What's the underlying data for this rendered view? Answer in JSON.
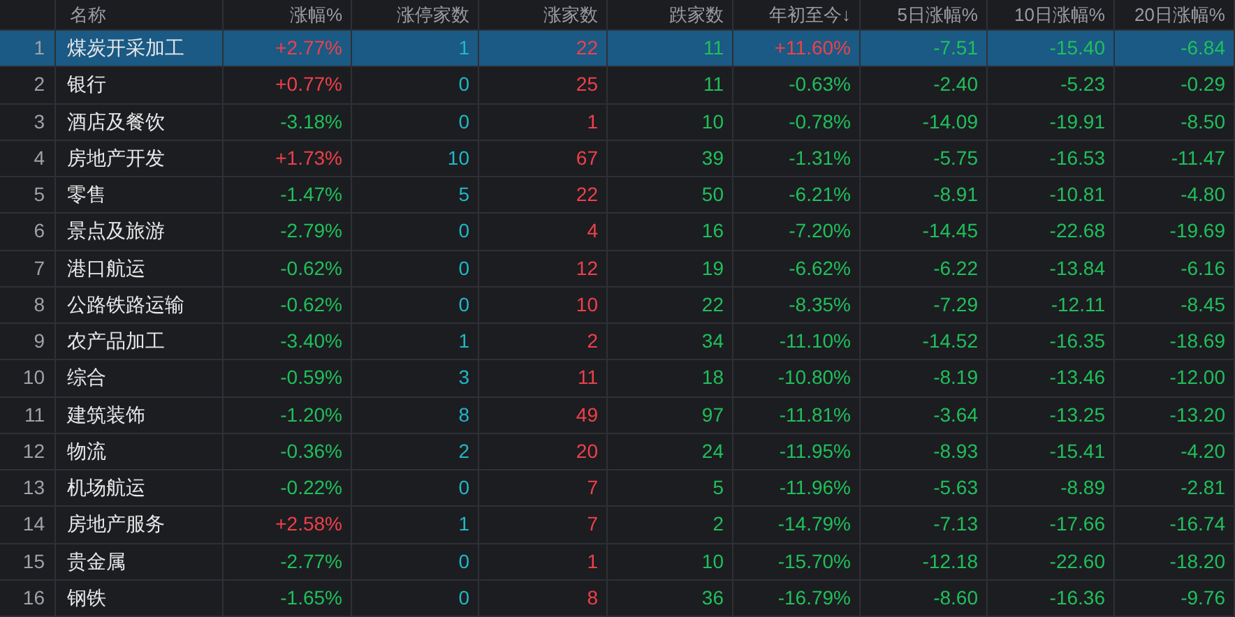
{
  "table": {
    "columns": [
      {
        "kind": "index"
      },
      {
        "label": "名称",
        "kind": "name"
      },
      {
        "label": "涨幅%",
        "kind": "change"
      },
      {
        "label": "涨停家数",
        "kind": "limit"
      },
      {
        "label": "涨家数",
        "kind": "up"
      },
      {
        "label": "跌家数",
        "kind": "down"
      },
      {
        "label": "年初至今↓",
        "kind": "change"
      },
      {
        "label": "5日涨幅%",
        "kind": "change"
      },
      {
        "label": "10日涨幅%",
        "kind": "change"
      },
      {
        "label": "20日涨幅%",
        "kind": "change"
      }
    ],
    "rows": [
      {
        "selected": true,
        "cells": [
          {
            "text": "1"
          },
          {
            "text": "煤炭开采加工"
          },
          {
            "text": "+2.77%",
            "color": "#f0404a"
          },
          {
            "text": "1"
          },
          {
            "text": "22"
          },
          {
            "text": "11"
          },
          {
            "text": "+11.60%",
            "color": "#f0404a"
          },
          {
            "text": "-7.51",
            "color": "#1fc05a"
          },
          {
            "text": "-15.40",
            "color": "#1fc05a"
          },
          {
            "text": "-6.84",
            "color": "#1fc05a"
          }
        ]
      },
      {
        "selected": false,
        "cells": [
          {
            "text": "2"
          },
          {
            "text": "银行"
          },
          {
            "text": "+0.77%",
            "color": "#f0404a"
          },
          {
            "text": "0"
          },
          {
            "text": "25"
          },
          {
            "text": "11"
          },
          {
            "text": "-0.63%",
            "color": "#1fc05a"
          },
          {
            "text": "-2.40",
            "color": "#1fc05a"
          },
          {
            "text": "-5.23",
            "color": "#1fc05a"
          },
          {
            "text": "-0.29",
            "color": "#1fc05a"
          }
        ]
      },
      {
        "selected": false,
        "cells": [
          {
            "text": "3"
          },
          {
            "text": "酒店及餐饮"
          },
          {
            "text": "-3.18%",
            "color": "#1fc05a"
          },
          {
            "text": "0"
          },
          {
            "text": "1"
          },
          {
            "text": "10"
          },
          {
            "text": "-0.78%",
            "color": "#1fc05a"
          },
          {
            "text": "-14.09",
            "color": "#1fc05a"
          },
          {
            "text": "-19.91",
            "color": "#1fc05a"
          },
          {
            "text": "-8.50",
            "color": "#1fc05a"
          }
        ]
      },
      {
        "selected": false,
        "cells": [
          {
            "text": "4"
          },
          {
            "text": "房地产开发"
          },
          {
            "text": "+1.73%",
            "color": "#f0404a"
          },
          {
            "text": "10"
          },
          {
            "text": "67"
          },
          {
            "text": "39"
          },
          {
            "text": "-1.31%",
            "color": "#1fc05a"
          },
          {
            "text": "-5.75",
            "color": "#1fc05a"
          },
          {
            "text": "-16.53",
            "color": "#1fc05a"
          },
          {
            "text": "-11.47",
            "color": "#1fc05a"
          }
        ]
      },
      {
        "selected": false,
        "cells": [
          {
            "text": "5"
          },
          {
            "text": "零售"
          },
          {
            "text": "-1.47%",
            "color": "#1fc05a"
          },
          {
            "text": "5"
          },
          {
            "text": "22"
          },
          {
            "text": "50"
          },
          {
            "text": "-6.21%",
            "color": "#1fc05a"
          },
          {
            "text": "-8.91",
            "color": "#1fc05a"
          },
          {
            "text": "-10.81",
            "color": "#1fc05a"
          },
          {
            "text": "-4.80",
            "color": "#1fc05a"
          }
        ]
      },
      {
        "selected": false,
        "cells": [
          {
            "text": "6"
          },
          {
            "text": "景点及旅游"
          },
          {
            "text": "-2.79%",
            "color": "#1fc05a"
          },
          {
            "text": "0"
          },
          {
            "text": "4"
          },
          {
            "text": "16"
          },
          {
            "text": "-7.20%",
            "color": "#1fc05a"
          },
          {
            "text": "-14.45",
            "color": "#1fc05a"
          },
          {
            "text": "-22.68",
            "color": "#1fc05a"
          },
          {
            "text": "-19.69",
            "color": "#1fc05a"
          }
        ]
      },
      {
        "selected": false,
        "cells": [
          {
            "text": "7"
          },
          {
            "text": "港口航运"
          },
          {
            "text": "-0.62%",
            "color": "#1fc05a"
          },
          {
            "text": "0"
          },
          {
            "text": "12"
          },
          {
            "text": "19"
          },
          {
            "text": "-6.62%",
            "color": "#1fc05a"
          },
          {
            "text": "-6.22",
            "color": "#1fc05a"
          },
          {
            "text": "-13.84",
            "color": "#1fc05a"
          },
          {
            "text": "-6.16",
            "color": "#1fc05a"
          }
        ]
      },
      {
        "selected": false,
        "cells": [
          {
            "text": "8"
          },
          {
            "text": "公路铁路运输"
          },
          {
            "text": "-0.62%",
            "color": "#1fc05a"
          },
          {
            "text": "0"
          },
          {
            "text": "10"
          },
          {
            "text": "22"
          },
          {
            "text": "-8.35%",
            "color": "#1fc05a"
          },
          {
            "text": "-7.29",
            "color": "#1fc05a"
          },
          {
            "text": "-12.11",
            "color": "#1fc05a"
          },
          {
            "text": "-8.45",
            "color": "#1fc05a"
          }
        ]
      },
      {
        "selected": false,
        "cells": [
          {
            "text": "9"
          },
          {
            "text": "农产品加工"
          },
          {
            "text": "-3.40%",
            "color": "#1fc05a"
          },
          {
            "text": "1"
          },
          {
            "text": "2"
          },
          {
            "text": "34"
          },
          {
            "text": "-11.10%",
            "color": "#1fc05a"
          },
          {
            "text": "-14.52",
            "color": "#1fc05a"
          },
          {
            "text": "-16.35",
            "color": "#1fc05a"
          },
          {
            "text": "-18.69",
            "color": "#1fc05a"
          }
        ]
      },
      {
        "selected": false,
        "cells": [
          {
            "text": "10"
          },
          {
            "text": "综合"
          },
          {
            "text": "-0.59%",
            "color": "#1fc05a"
          },
          {
            "text": "3"
          },
          {
            "text": "11"
          },
          {
            "text": "18"
          },
          {
            "text": "-10.80%",
            "color": "#1fc05a"
          },
          {
            "text": "-8.19",
            "color": "#1fc05a"
          },
          {
            "text": "-13.46",
            "color": "#1fc05a"
          },
          {
            "text": "-12.00",
            "color": "#1fc05a"
          }
        ]
      },
      {
        "selected": false,
        "cells": [
          {
            "text": "11"
          },
          {
            "text": "建筑装饰"
          },
          {
            "text": "-1.20%",
            "color": "#1fc05a"
          },
          {
            "text": "8"
          },
          {
            "text": "49"
          },
          {
            "text": "97"
          },
          {
            "text": "-11.81%",
            "color": "#1fc05a"
          },
          {
            "text": "-3.64",
            "color": "#1fc05a"
          },
          {
            "text": "-13.25",
            "color": "#1fc05a"
          },
          {
            "text": "-13.20",
            "color": "#1fc05a"
          }
        ]
      },
      {
        "selected": false,
        "cells": [
          {
            "text": "12"
          },
          {
            "text": "物流"
          },
          {
            "text": "-0.36%",
            "color": "#1fc05a"
          },
          {
            "text": "2"
          },
          {
            "text": "20"
          },
          {
            "text": "24"
          },
          {
            "text": "-11.95%",
            "color": "#1fc05a"
          },
          {
            "text": "-8.93",
            "color": "#1fc05a"
          },
          {
            "text": "-15.41",
            "color": "#1fc05a"
          },
          {
            "text": "-4.20",
            "color": "#1fc05a"
          }
        ]
      },
      {
        "selected": false,
        "cells": [
          {
            "text": "13"
          },
          {
            "text": "机场航运"
          },
          {
            "text": "-0.22%",
            "color": "#1fc05a"
          },
          {
            "text": "0"
          },
          {
            "text": "7"
          },
          {
            "text": "5"
          },
          {
            "text": "-11.96%",
            "color": "#1fc05a"
          },
          {
            "text": "-5.63",
            "color": "#1fc05a"
          },
          {
            "text": "-8.89",
            "color": "#1fc05a"
          },
          {
            "text": "-2.81",
            "color": "#1fc05a"
          }
        ]
      },
      {
        "selected": false,
        "cells": [
          {
            "text": "14"
          },
          {
            "text": "房地产服务"
          },
          {
            "text": "+2.58%",
            "color": "#f0404a"
          },
          {
            "text": "1"
          },
          {
            "text": "7"
          },
          {
            "text": "2"
          },
          {
            "text": "-14.79%",
            "color": "#1fc05a"
          },
          {
            "text": "-7.13",
            "color": "#1fc05a"
          },
          {
            "text": "-17.66",
            "color": "#1fc05a"
          },
          {
            "text": "-16.74",
            "color": "#1fc05a"
          }
        ]
      },
      {
        "selected": false,
        "cells": [
          {
            "text": "15"
          },
          {
            "text": "贵金属"
          },
          {
            "text": "-2.77%",
            "color": "#1fc05a"
          },
          {
            "text": "0"
          },
          {
            "text": "1"
          },
          {
            "text": "10"
          },
          {
            "text": "-15.70%",
            "color": "#1fc05a"
          },
          {
            "text": "-12.18",
            "color": "#1fc05a"
          },
          {
            "text": "-22.60",
            "color": "#1fc05a"
          },
          {
            "text": "-18.20",
            "color": "#1fc05a"
          }
        ]
      },
      {
        "selected": false,
        "cells": [
          {
            "text": "16"
          },
          {
            "text": "钢铁"
          },
          {
            "text": "-1.65%",
            "color": "#1fc05a"
          },
          {
            "text": "0"
          },
          {
            "text": "8"
          },
          {
            "text": "36"
          },
          {
            "text": "-16.79%",
            "color": "#1fc05a"
          },
          {
            "text": "-8.60",
            "color": "#1fc05a"
          },
          {
            "text": "-16.36",
            "color": "#1fc05a"
          },
          {
            "text": "-9.76",
            "color": "#1fc05a"
          }
        ]
      }
    ]
  }
}
